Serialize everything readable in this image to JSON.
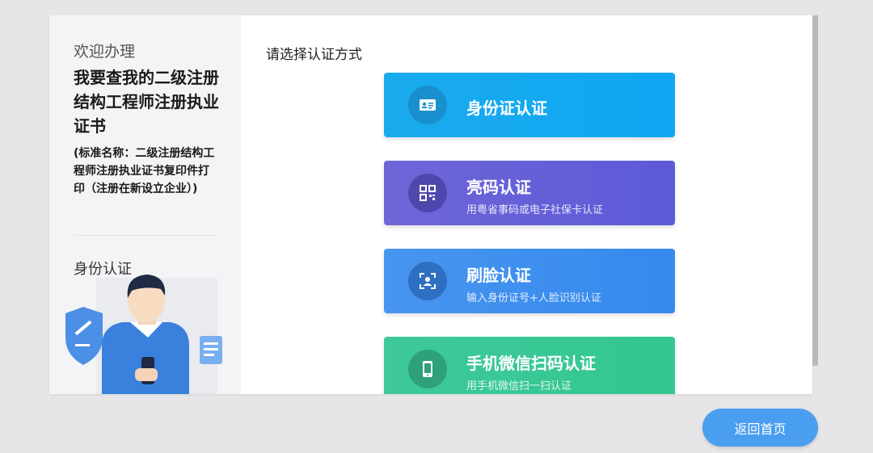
{
  "sidebar": {
    "welcome": "欢迎办理",
    "service_title": "我要查我的二级注册结构工程师注册执业证书",
    "standard_name": "(标准名称：二级注册结构工程师注册执业证书复印件打印（注册在新设立企业）)",
    "step_label": "身份认证"
  },
  "main": {
    "prompt": "请选择认证方式",
    "auth_options": [
      {
        "label": "身份证认证",
        "sub": "",
        "icon": "id-card-icon"
      },
      {
        "label": "亮码认证",
        "sub": "用粤省事码或电子社保卡认证",
        "icon": "qr-code-icon"
      },
      {
        "label": "刷脸认证",
        "sub": "输入身份证号+人脸识别认证",
        "icon": "face-scan-icon"
      },
      {
        "label": "手机微信扫码认证",
        "sub": "用手机微信扫一扫认证",
        "icon": "mobile-phone-icon"
      }
    ]
  },
  "footer": {
    "back_label": "返回首页"
  },
  "colors": {
    "id_button": "#0fa6f2",
    "code_button": "#5c5ad8",
    "face_button": "#3589ee",
    "wechat_button": "#33c78f",
    "back_button": "#4a9ef0"
  }
}
